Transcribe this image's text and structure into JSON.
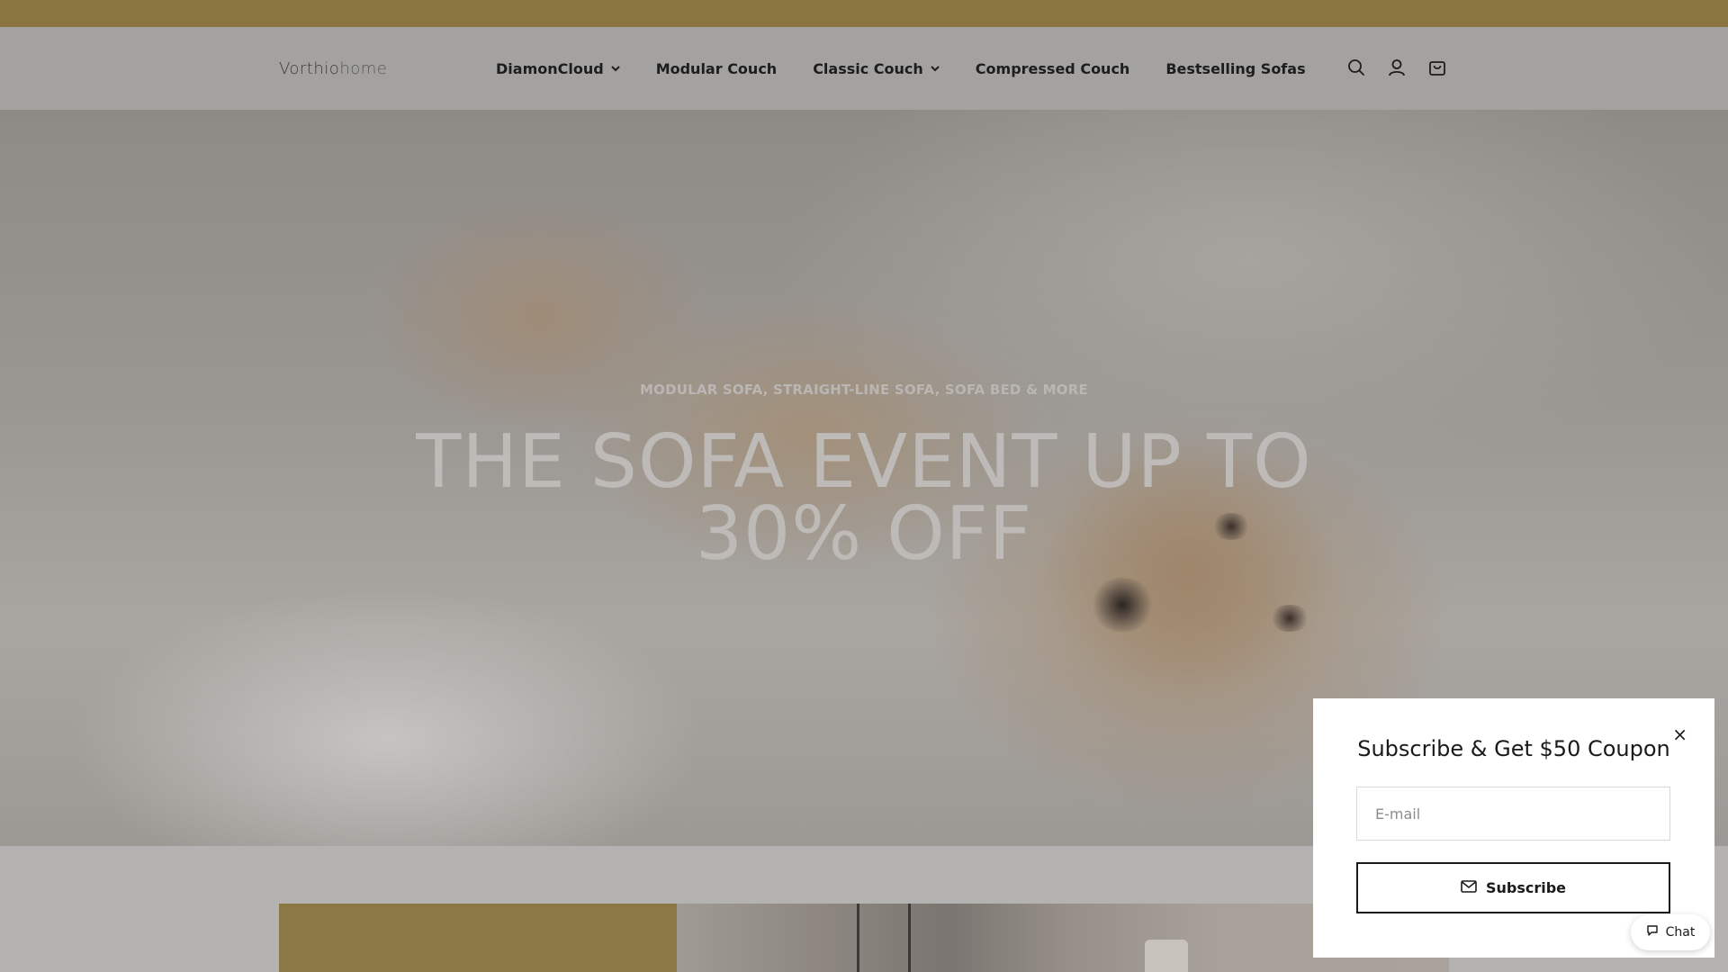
{
  "brand": {
    "logo_dark": "Vorthio",
    "logo_light": "home"
  },
  "nav": {
    "items": [
      {
        "label": "DiamonCloud",
        "has_dropdown": true
      },
      {
        "label": "Modular Couch",
        "has_dropdown": false
      },
      {
        "label": "Classic Couch",
        "has_dropdown": true
      },
      {
        "label": "Compressed Couch",
        "has_dropdown": false
      },
      {
        "label": "Bestselling Sofas",
        "has_dropdown": false
      }
    ]
  },
  "header_icons": [
    "search-icon",
    "account-icon",
    "cart-icon"
  ],
  "hero": {
    "eyebrow": "MODULAR SOFA, STRAIGHT-LINE SOFA, SOFA BED & MORE",
    "title_line1": "THE SOFA EVENT UP TO",
    "title_line2": "30% OFF"
  },
  "popup": {
    "title": "Subscribe & Get $50 Coupon",
    "email_placeholder": "E-mail",
    "email_value": "",
    "subscribe_label": "Subscribe",
    "close_symbol": "×"
  },
  "chat": {
    "label": "Chat"
  },
  "colors": {
    "announcement_bar": "#8a7541",
    "promo_gold": "#8c7844",
    "overlay_dim": "rgba(0,0,0,0.3)"
  }
}
